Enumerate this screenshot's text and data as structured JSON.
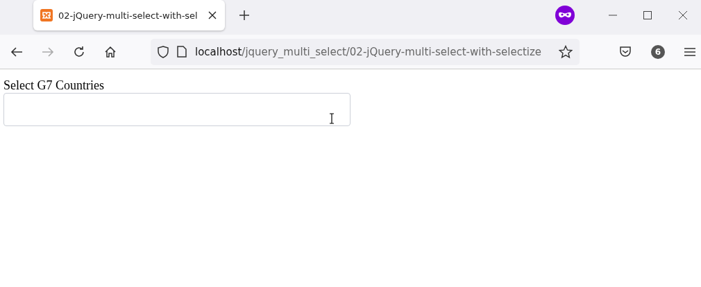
{
  "tabs": [
    {
      "title": "02-jQuery-multi-select-with-sel",
      "selected": true
    }
  ],
  "address_bar": {
    "host": "localhost",
    "path": "/jquery_multi_select/02-jQuery-multi-select-with-selectize"
  },
  "toolbar": {
    "extensions_badge": "6"
  },
  "page": {
    "label": "Select G7 Countries"
  }
}
